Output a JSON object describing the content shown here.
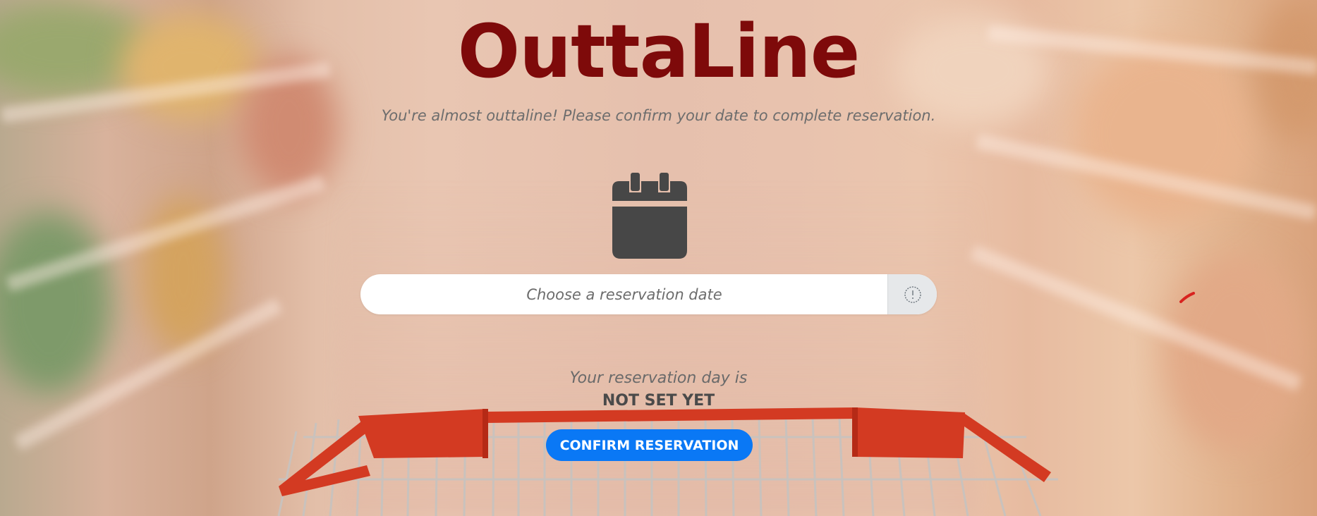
{
  "app": {
    "title": "OuttaLine",
    "subtitle": "You're almost outtaline! Please confirm your date to complete reservation."
  },
  "date_picker": {
    "placeholder": "Choose a reservation date",
    "value": ""
  },
  "reservation": {
    "label": "Your reservation day is",
    "status": "NOT SET YET"
  },
  "actions": {
    "confirm_label": "CONFIRM RESERVATION"
  },
  "icons": {
    "calendar": "calendar-icon",
    "date_toggle": "clock-icon",
    "background": "shopping-cart-aisle-photo"
  },
  "colors": {
    "brand": "#7e0a0a",
    "button": "#0a78f5",
    "calendar_icon": "#474747",
    "cart": "#d7321e"
  }
}
